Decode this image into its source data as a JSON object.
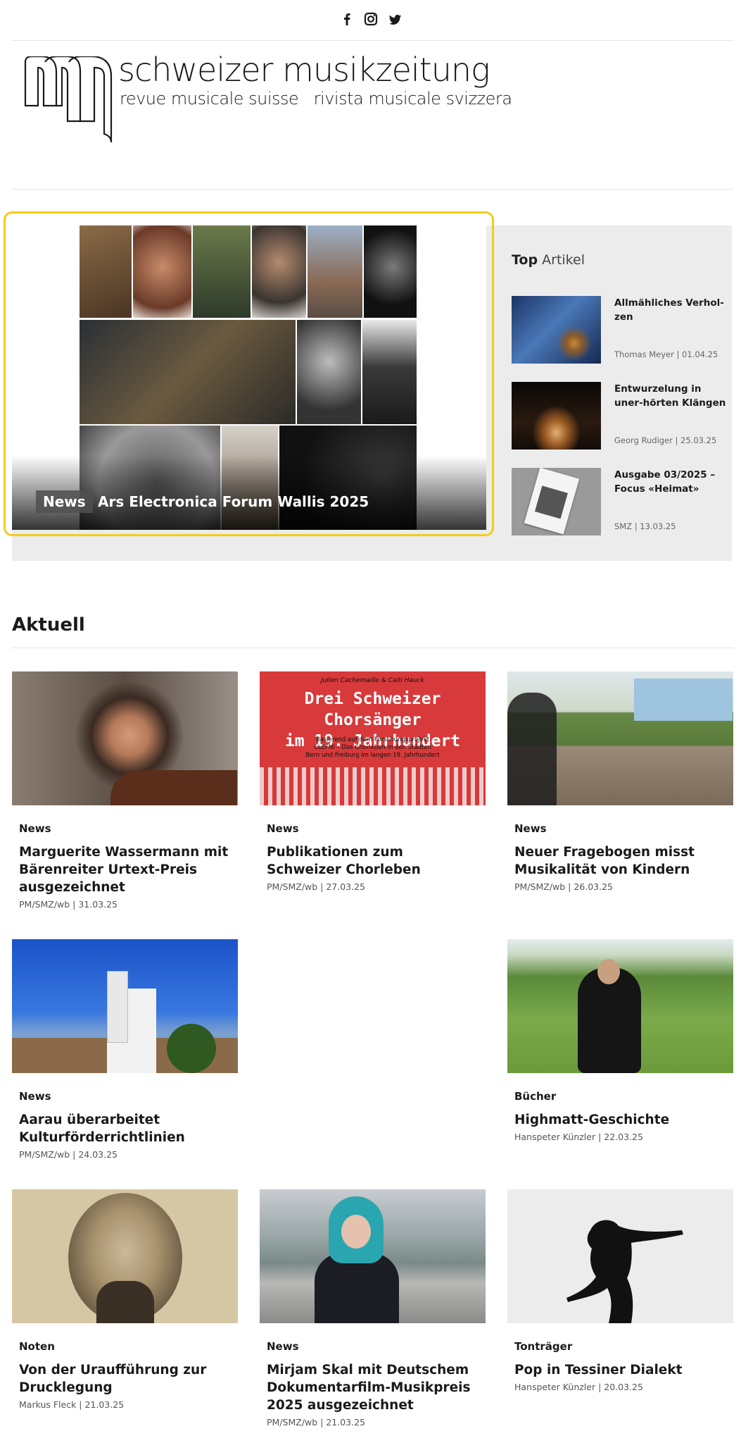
{
  "social": {
    "icons": [
      "facebook-icon",
      "instagram-icon",
      "twitter-icon"
    ]
  },
  "logo": {
    "title": "schweizer musikzeitung",
    "subtitle": "revue musicale suisse   rivista musicale svizzera"
  },
  "hero": {
    "badge": "News",
    "title": "Ars Electronica Forum Wallis 2025"
  },
  "top_artikel": {
    "heading_bold": "Top",
    "heading_light": "Artikel",
    "items": [
      {
        "title": "Allmähliches Verhol-zen",
        "meta": "Thomas Meyer | 01.04.25"
      },
      {
        "title": "Entwurzelung in uner-hörten Klängen",
        "meta": "Georg Rudiger | 25.03.25"
      },
      {
        "title": "Ausgabe 03/2025 – Focus «Heimat»",
        "meta": "SMZ | 13.03.25"
      }
    ]
  },
  "aktuell": {
    "heading": "Aktuell",
    "cards": [
      {
        "category": "News",
        "title": "Marguerite Wassermann mit Bärenreiter Urtext-Preis ausgezeichnet",
        "meta": "PM/SMZ/wb | 31.03.25"
      },
      {
        "category": "News",
        "title": "Publikationen zum Schweizer Chorleben",
        "meta": "PM/SMZ/wb | 27.03.25",
        "poster": {
          "top": "Julien Cachemaille & Caiti Hauck",
          "title_line1": "Drei Schweizer Chorsänger",
          "title_line2": "im 19. Jahrhundert",
          "sub1": "Basierend auf dem Forschungsprojekt",
          "sub2": "CLEFNI – Das Chorleben in den Städten",
          "sub3": "Bern und Freiburg im langen 19. Jahrhundert"
        }
      },
      {
        "category": "News",
        "title": "Neuer Fragebogen misst Musikalität von Kindern",
        "meta": "PM/SMZ/wb | 26.03.25"
      },
      {
        "category": "News",
        "title": "Aarau überarbeitet Kulturförderrichtlinien",
        "meta": "PM/SMZ/wb | 24.03.25"
      },
      {
        "category": "Bücher",
        "title": "Highmatt-Geschichte",
        "meta": "Hanspeter Künzler | 22.03.25"
      },
      {
        "category": "Noten",
        "title": "Von der Uraufführung zur Drucklegung",
        "meta": "Markus Fleck | 21.03.25"
      },
      {
        "category": "News",
        "title": "Mirjam Skal mit Deutschem Dokumentarfilm-Musikpreis 2025 ausgezeichnet",
        "meta": "PM/SMZ/wb | 21.03.25"
      },
      {
        "category": "Tonträger",
        "title": "Pop in Tessiner Dialekt",
        "meta": "Hanspeter Künzler | 20.03.25"
      }
    ]
  },
  "colors": {
    "accent_outline": "#f2cc1c",
    "panel_bg": "#ececec",
    "poster_red": "#d8393a"
  }
}
